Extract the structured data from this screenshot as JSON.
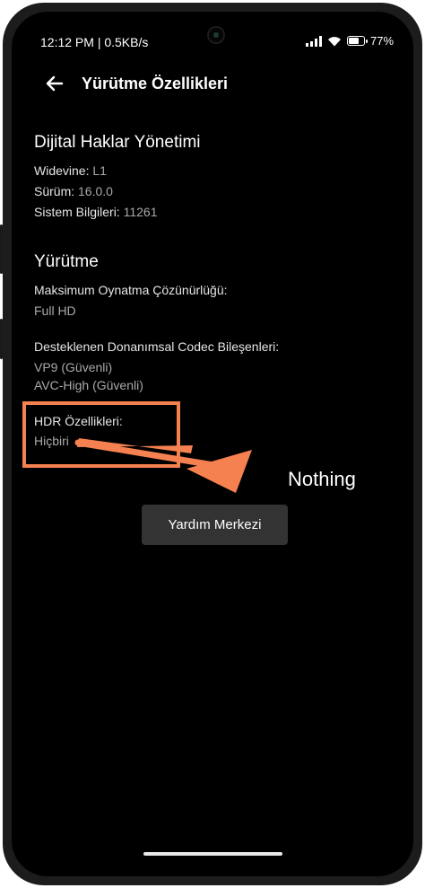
{
  "status_bar": {
    "time": "12:12 PM | 0.5KB/s",
    "battery": "77"
  },
  "header": {
    "title": "Yürütme Özellikleri"
  },
  "drm": {
    "title": "Dijital Haklar Yönetimi",
    "widevine_label": "Widevine:",
    "widevine_value": "L1",
    "version_label": "Sürüm:",
    "version_value": "16.0.0",
    "system_label": "Sistem Bilgileri:",
    "system_value": "11261"
  },
  "playback": {
    "title": "Yürütme",
    "max_res_label": "Maksimum Oynatma Çözünürlüğü:",
    "max_res_value": "Full HD",
    "codec_label": "Desteklenen Donanımsal Codec Bileşenleri:",
    "codecs": [
      "VP9 (Güvenli)",
      "AVC-High (Güvenli)"
    ],
    "hdr_label": "HDR Özellikleri:",
    "hdr_value": "Hiçbiri"
  },
  "help_button": {
    "label": "Yardım Merkezi"
  },
  "annotation": {
    "text": "Nothing",
    "color": "#f58050"
  }
}
